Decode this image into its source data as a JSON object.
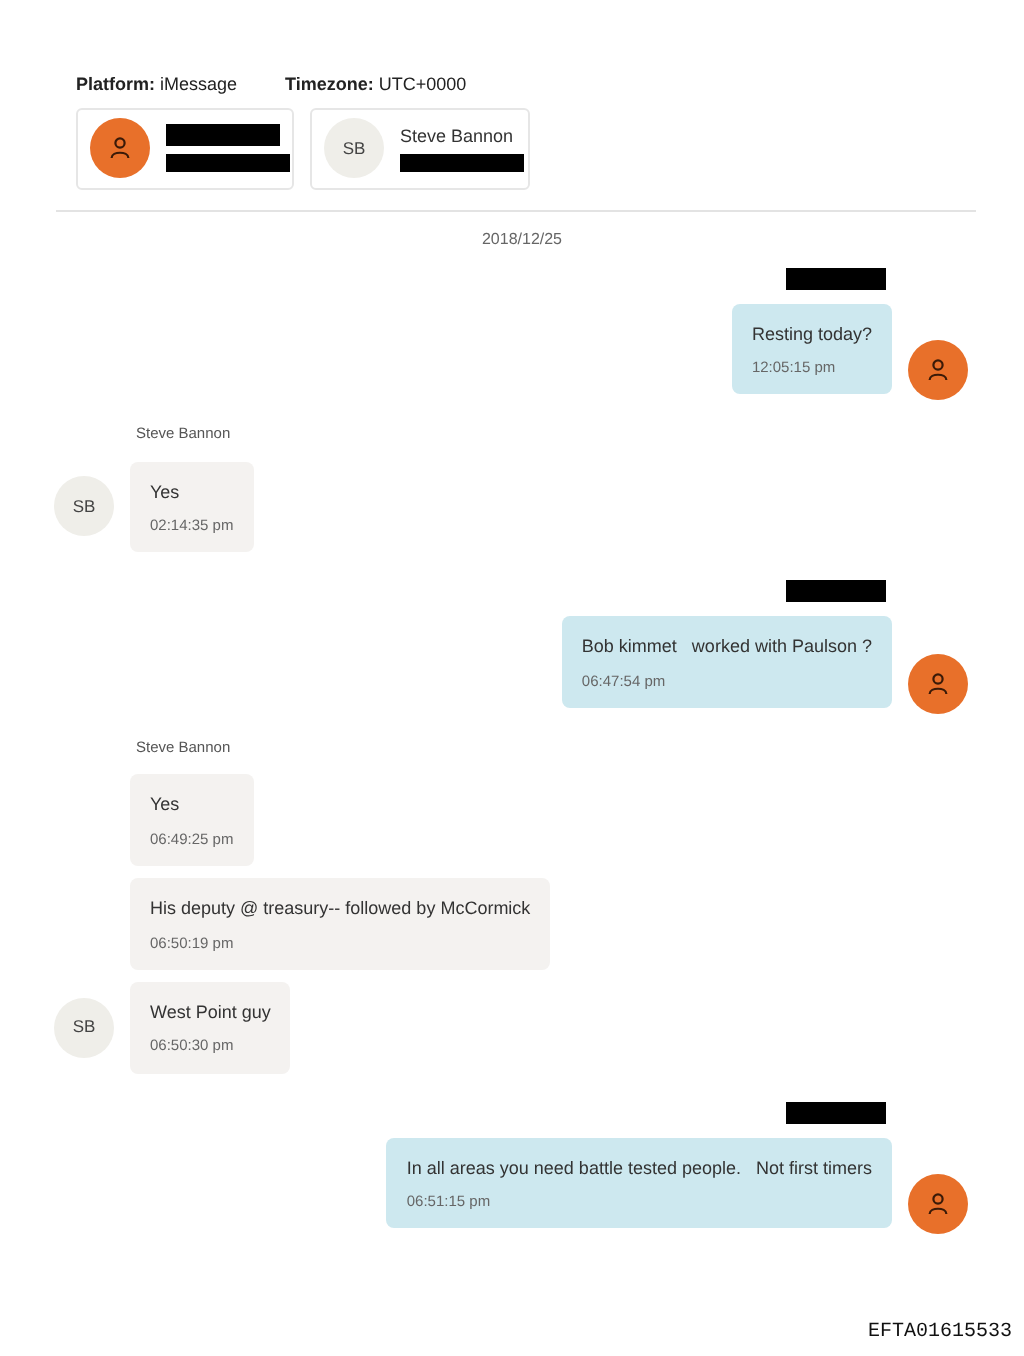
{
  "header": {
    "platform_label": "Platform:",
    "platform": "iMessage",
    "timezone_label": "Timezone:",
    "timezone": "UTC+0000"
  },
  "participants": [
    {
      "kind": "redacted"
    },
    {
      "kind": "named",
      "name": "Steve Bannon",
      "initials": "SB"
    }
  ],
  "date": "2018/12/25",
  "groups": [
    {
      "kind": "outgoing",
      "messages": [
        {
          "text": "Resting today?",
          "time": "12:05:15 pm"
        }
      ]
    },
    {
      "kind": "incoming",
      "sender": "Steve Bannon",
      "initials": "SB",
      "messages": [
        {
          "text": "Yes",
          "time": "02:14:35 pm"
        }
      ]
    },
    {
      "kind": "outgoing",
      "messages": [
        {
          "text": "Bob kimmet   worked with Paulson ?",
          "time": "06:47:54 pm"
        }
      ]
    },
    {
      "kind": "incoming",
      "sender": "Steve Bannon",
      "initials": "SB",
      "messages": [
        {
          "text": "Yes",
          "time": "06:49:25 pm"
        },
        {
          "text": "His deputy @ treasury-- followed by McCormick",
          "time": "06:50:19 pm"
        },
        {
          "text": "West Point guy",
          "time": "06:50:30 pm"
        }
      ]
    },
    {
      "kind": "outgoing",
      "messages": [
        {
          "text": "In all areas you need battle tested people.   Not first timers",
          "time": "06:51:15 pm"
        }
      ]
    }
  ],
  "stamp": "EFTA01615533"
}
